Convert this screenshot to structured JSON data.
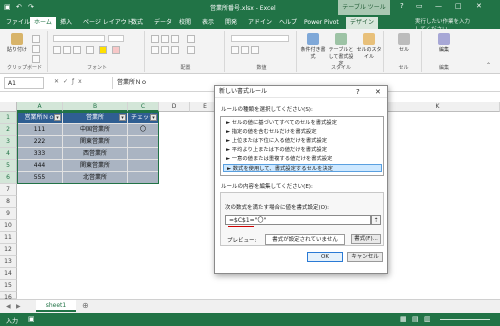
{
  "window": {
    "title": "営業所番号.xlsx - Excel",
    "context_tab": "テーブル ツール",
    "controls": [
      "?",
      "▭",
      "—",
      "□",
      "✕"
    ]
  },
  "ribbon_tabs": [
    "ファイル",
    "ホーム",
    "挿入",
    "ページ レイアウト",
    "数式",
    "データ",
    "校閲",
    "表示",
    "開発",
    "アドイン",
    "ヘルプ",
    "Power Pivot",
    "デザイン"
  ],
  "search_placeholder": "実行したい作業を入力してください",
  "ribbon_groups": [
    "クリップボード",
    "フォント",
    "配置",
    "数値",
    "スタイル",
    "セル",
    "編集"
  ],
  "ribbon_buttons": {
    "paste": "貼り付け",
    "cond_format": "条件付き書式",
    "table_format": "テーブルとして書式設定",
    "cell_styles": "セルのスタイル",
    "cells": "セル",
    "editing": "編集"
  },
  "formula_bar": {
    "name_box": "A1",
    "content": "営業所Ｎｏ"
  },
  "grid": {
    "columns": [
      "A",
      "B",
      "C",
      "D",
      "E",
      "F",
      "G",
      "H",
      "I",
      "J",
      "K"
    ],
    "rows": [
      "1",
      "2",
      "3",
      "4",
      "5",
      "6",
      "7",
      "8",
      "9",
      "10",
      "11",
      "12",
      "13",
      "14",
      "15",
      "16"
    ],
    "table_headers": [
      "営業所Ｎｏ",
      "営業所",
      "チェック"
    ],
    "table_rows": [
      [
        "111",
        "中国営業所",
        "〇"
      ],
      [
        "222",
        "関東営業所",
        ""
      ],
      [
        "333",
        "西営業所",
        ""
      ],
      [
        "444",
        "関東営業所",
        ""
      ],
      [
        "555",
        "北営業所",
        ""
      ]
    ]
  },
  "sheet_tab": "sheet1",
  "status": {
    "mode": "入力"
  },
  "dialog": {
    "title": "新しい書式ルール",
    "help": "?",
    "close": "✕",
    "select_label": "ルールの種類を選択してください(S):",
    "rule_types": [
      "► セルの値に基づいてすべてのセルを書式設定",
      "► 指定の値を含むセルだけを書式設定",
      "► 上位または下位に入る値だけを書式設定",
      "► 平均より上または下の値だけを書式設定",
      "► 一意の値または重複する値だけを書式設定",
      "► 数式を使用して、書式設定するセルを決定"
    ],
    "edit_label": "ルールの内容を編集してください(E):",
    "formula_label": "次の数式を満たす場合に値を書式設定(O):",
    "formula_value": "=$C$1=\"〇\"",
    "ref_button": "⇡",
    "preview_label": "プレビュー:",
    "preview_text": "書式が設定されていません",
    "format_button": "書式(F)...",
    "ok": "OK",
    "cancel": "キャンセル"
  }
}
